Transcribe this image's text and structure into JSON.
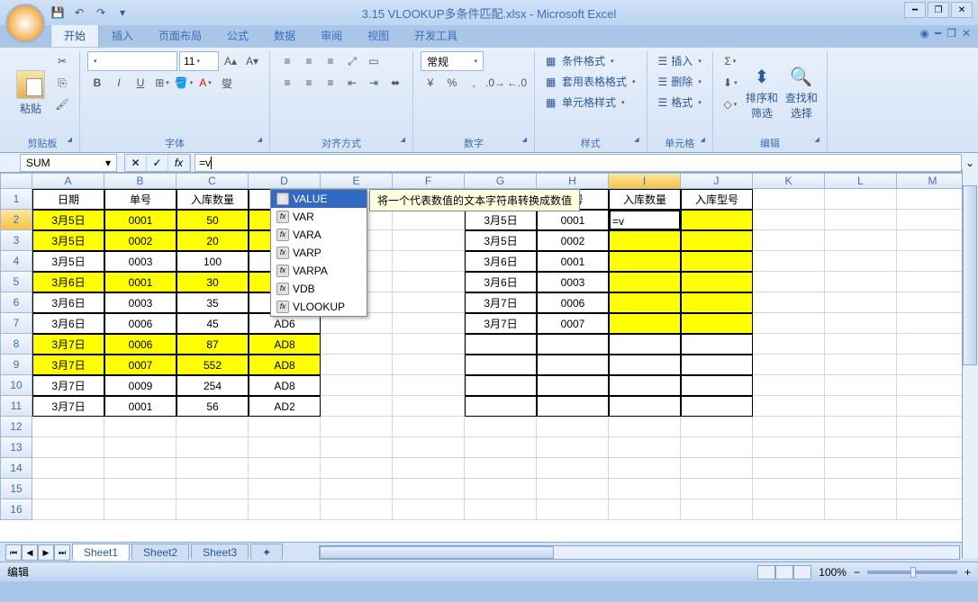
{
  "title": "3.15 VLOOKUP多条件匹配.xlsx - Microsoft Excel",
  "tabs": [
    "开始",
    "插入",
    "页面布局",
    "公式",
    "数据",
    "审阅",
    "视图",
    "开发工具"
  ],
  "groups": {
    "clipboard": "剪贴板",
    "font": "字体",
    "align": "对齐方式",
    "number": "数字",
    "styles": "样式",
    "cells": "单元格",
    "editing": "编辑"
  },
  "paste": "粘贴",
  "fontsize": "11",
  "numfmt": "常规",
  "styles": {
    "cond": "条件格式",
    "table": "套用表格格式",
    "cell": "单元格样式"
  },
  "cells": {
    "insert": "插入",
    "delete": "删除",
    "format": "格式"
  },
  "editing": {
    "sort": "排序和\n筛选",
    "find": "查找和\n选择"
  },
  "namebox": "SUM",
  "formula": "=v",
  "autocomplete": [
    "VALUE",
    "VAR",
    "VARA",
    "VARP",
    "VARPA",
    "VDB",
    "VLOOKUP"
  ],
  "tooltip": "将一个代表数值的文本字符串转换成数值",
  "cols": [
    "A",
    "B",
    "C",
    "D",
    "E",
    "F",
    "G",
    "H",
    "I",
    "J",
    "K",
    "L",
    "M"
  ],
  "headers1": {
    "A": "日期",
    "B": "单号",
    "C": "入库数量",
    "D": "入"
  },
  "headers2": {
    "G": "日期",
    "H": "单号",
    "I": "入库数量",
    "J": "入库型号"
  },
  "data1": [
    {
      "A": "3月5日",
      "B": "0001",
      "C": "50",
      "D": "",
      "hl": true
    },
    {
      "A": "3月5日",
      "B": "0002",
      "C": "20",
      "D": "",
      "hl": true
    },
    {
      "A": "3月5日",
      "B": "0003",
      "C": "100",
      "D": ""
    },
    {
      "A": "3月6日",
      "B": "0001",
      "C": "30",
      "D": "",
      "hl": true
    },
    {
      "A": "3月6日",
      "B": "0003",
      "C": "35",
      "D": "AD6"
    },
    {
      "A": "3月6日",
      "B": "0006",
      "C": "45",
      "D": "AD6"
    },
    {
      "A": "3月7日",
      "B": "0006",
      "C": "87",
      "D": "AD8",
      "hl": true
    },
    {
      "A": "3月7日",
      "B": "0007",
      "C": "552",
      "D": "AD8",
      "hl": true
    },
    {
      "A": "3月7日",
      "B": "0009",
      "C": "254",
      "D": "AD8"
    },
    {
      "A": "3月7日",
      "B": "0001",
      "C": "56",
      "D": "AD2"
    }
  ],
  "data2": [
    {
      "G": "3月5日",
      "H": "0001",
      "I": "=v",
      "active": true
    },
    {
      "G": "3月5日",
      "H": "0002"
    },
    {
      "G": "3月6日",
      "H": "0001"
    },
    {
      "G": "3月6日",
      "H": "0003"
    },
    {
      "G": "3月7日",
      "H": "0006"
    },
    {
      "G": "3月7日",
      "H": "0007"
    }
  ],
  "sheets": [
    "Sheet1",
    "Sheet2",
    "Sheet3"
  ],
  "status": "编辑",
  "zoom": "100%"
}
